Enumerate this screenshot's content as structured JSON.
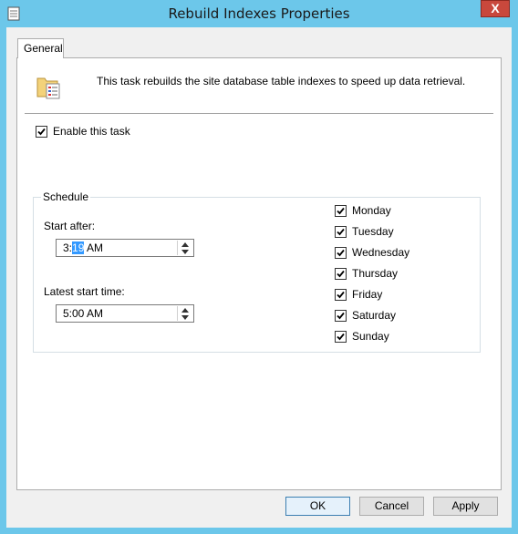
{
  "window": {
    "title": "Rebuild Indexes Properties",
    "close_glyph": "X",
    "accent_color": "#6cc7ea",
    "close_color": "#c9483c"
  },
  "tabs": [
    {
      "label": "General",
      "selected": true
    }
  ],
  "general": {
    "description": "This task rebuilds the site database table indexes to speed up data retrieval.",
    "header_icon": "task-properties-icon",
    "enable_task": {
      "label": "Enable this task",
      "checked": true
    }
  },
  "schedule": {
    "legend": "Schedule",
    "start_after": {
      "label": "Start after:",
      "value_prefix": "3:",
      "value_selected": "19",
      "value_suffix": " AM"
    },
    "latest_start": {
      "label": "Latest start time:",
      "value": "5:00 AM"
    },
    "days": [
      {
        "label": "Monday",
        "checked": true
      },
      {
        "label": "Tuesday",
        "checked": true
      },
      {
        "label": "Wednesday",
        "checked": true
      },
      {
        "label": "Thursday",
        "checked": true
      },
      {
        "label": "Friday",
        "checked": true
      },
      {
        "label": "Saturday",
        "checked": true
      },
      {
        "label": "Sunday",
        "checked": true
      }
    ]
  },
  "buttons": {
    "ok": "OK",
    "cancel": "Cancel",
    "apply": "Apply"
  }
}
